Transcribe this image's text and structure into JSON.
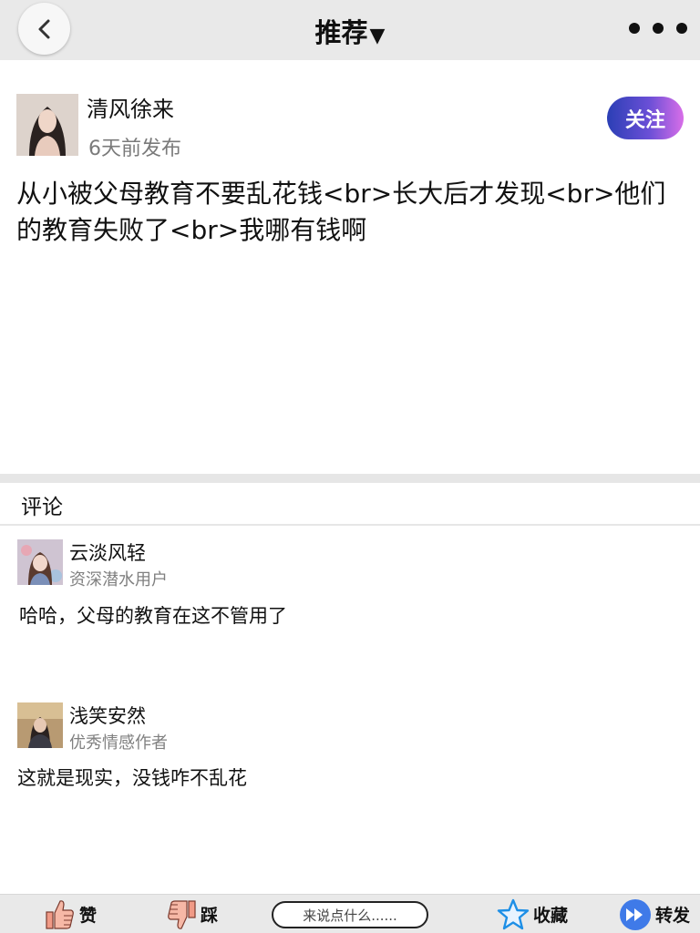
{
  "nav": {
    "title": "推荐",
    "caret": "▼",
    "back_icon": "chevron-left-icon",
    "more_icon": "more-dots-icon"
  },
  "post": {
    "author_name": "清风徐来",
    "time": "6天前发布",
    "follow_label": "关注",
    "content": "从小被父母教育不要乱花钱<br>长大后才发现<br>他们的教育失败了<br>我哪有钱啊"
  },
  "comments": {
    "title": "评论",
    "items": [
      {
        "name": "云淡风轻",
        "badge": "资深潜水用户",
        "text": "哈哈，父母的教育在这不管用了"
      },
      {
        "name": "浅笑安然",
        "badge": "优秀情感作者",
        "text": "这就是现实，没钱咋不乱花"
      }
    ]
  },
  "bottom": {
    "like_label": "赞",
    "dislike_label": "踩",
    "input_placeholder": "来说点什么......",
    "favorite_label": "收藏",
    "share_label": "转发"
  },
  "colors": {
    "follow_gradient_start": "#2b3fb5",
    "follow_gradient_end": "#d86ee8",
    "star": "#1e8fe6",
    "share": "#3f7ae8",
    "thumb": "#f09a86"
  }
}
